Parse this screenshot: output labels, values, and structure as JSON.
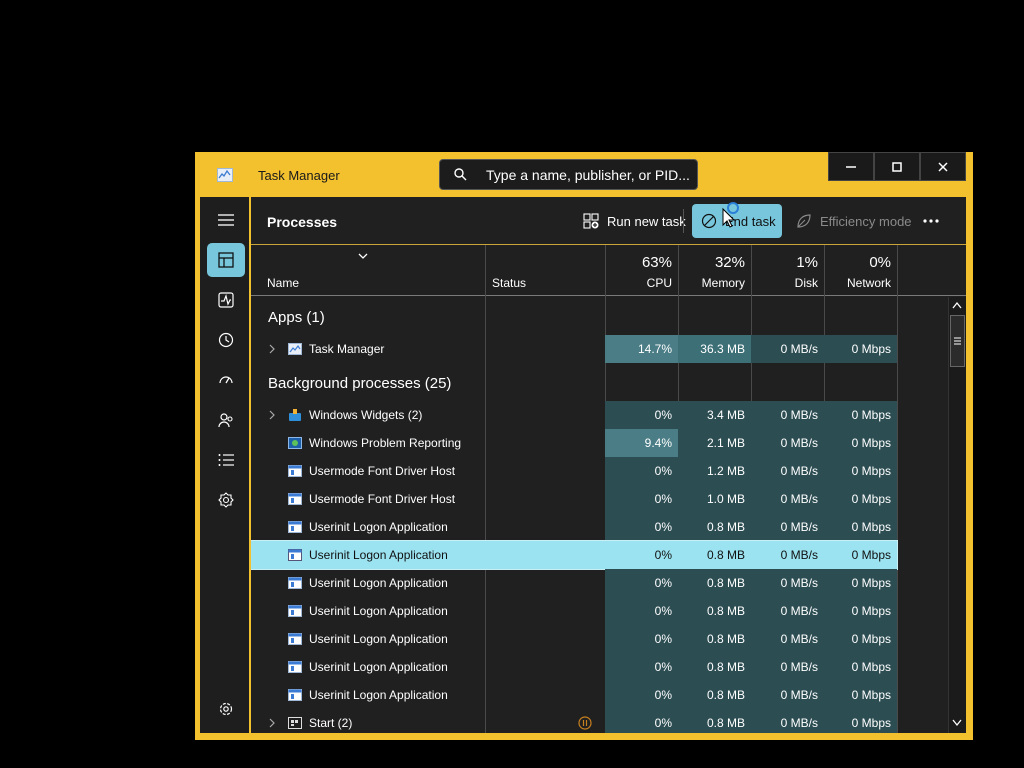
{
  "window": {
    "title": "Task Manager"
  },
  "search": {
    "placeholder": "Type a name, publisher, or PID..."
  },
  "toolbar": {
    "page_title": "Processes",
    "run_new_task": "Run new task",
    "end_task": "End task",
    "efficiency_mode": "Efficiency mode"
  },
  "columns": {
    "name": "Name",
    "status": "Status",
    "cpu": {
      "percent": "63%",
      "label": "CPU"
    },
    "memory": {
      "percent": "32%",
      "label": "Memory"
    },
    "disk": {
      "percent": "1%",
      "label": "Disk"
    },
    "network": {
      "percent": "0%",
      "label": "Network"
    }
  },
  "sections": {
    "apps": "Apps (1)",
    "background": "Background processes (25)"
  },
  "processes": [
    {
      "name": "Task Manager",
      "cpu": "14.7%",
      "memory": "36.3 MB",
      "disk": "0 MB/s",
      "network": "0 Mbps"
    },
    {
      "name": "Windows Widgets (2)",
      "cpu": "0%",
      "memory": "3.4 MB",
      "disk": "0 MB/s",
      "network": "0 Mbps"
    },
    {
      "name": "Windows Problem Reporting",
      "cpu": "9.4%",
      "memory": "2.1 MB",
      "disk": "0 MB/s",
      "network": "0 Mbps"
    },
    {
      "name": "Usermode Font Driver Host",
      "cpu": "0%",
      "memory": "1.2 MB",
      "disk": "0 MB/s",
      "network": "0 Mbps"
    },
    {
      "name": "Usermode Font Driver Host",
      "cpu": "0%",
      "memory": "1.0 MB",
      "disk": "0 MB/s",
      "network": "0 Mbps"
    },
    {
      "name": "Userinit Logon Application",
      "cpu": "0%",
      "memory": "0.8 MB",
      "disk": "0 MB/s",
      "network": "0 Mbps"
    },
    {
      "name": "Userinit Logon Application",
      "cpu": "0%",
      "memory": "0.8 MB",
      "disk": "0 MB/s",
      "network": "0 Mbps"
    },
    {
      "name": "Userinit Logon Application",
      "cpu": "0%",
      "memory": "0.8 MB",
      "disk": "0 MB/s",
      "network": "0 Mbps"
    },
    {
      "name": "Userinit Logon Application",
      "cpu": "0%",
      "memory": "0.8 MB",
      "disk": "0 MB/s",
      "network": "0 Mbps"
    },
    {
      "name": "Userinit Logon Application",
      "cpu": "0%",
      "memory": "0.8 MB",
      "disk": "0 MB/s",
      "network": "0 Mbps"
    },
    {
      "name": "Userinit Logon Application",
      "cpu": "0%",
      "memory": "0.8 MB",
      "disk": "0 MB/s",
      "network": "0 Mbps"
    },
    {
      "name": "Userinit Logon Application",
      "cpu": "0%",
      "memory": "0.8 MB",
      "disk": "0 MB/s",
      "network": "0 Mbps"
    },
    {
      "name": "Start (2)",
      "cpu": "0%",
      "memory": "0.8 MB",
      "disk": "0 MB/s",
      "network": "0 Mbps"
    }
  ],
  "colors": {
    "window_frame": "#f3c02e",
    "accent": "#77c6dc",
    "selected_row": "#9be3f1",
    "cpu_heat": "#4a7d86"
  },
  "icons": [
    "hamburger-icon",
    "processes-icon",
    "performance-icon",
    "app-history-icon",
    "startup-apps-icon",
    "users-icon",
    "details-icon",
    "services-icon",
    "settings-icon"
  ]
}
